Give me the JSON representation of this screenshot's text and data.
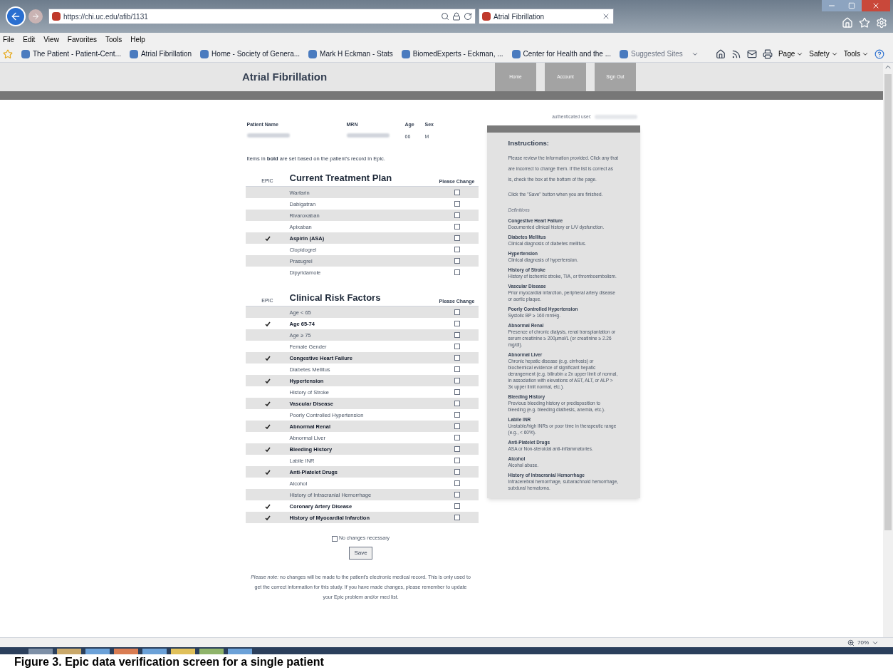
{
  "browser": {
    "url": "https://chi.uc.edu/afib/1131",
    "tab_title": "Atrial Fibrillation",
    "menu": [
      "File",
      "Edit",
      "View",
      "Favorites",
      "Tools",
      "Help"
    ],
    "favorites": [
      "The Patient - Patient-Cent...",
      "Atrial Fibrillation",
      "Home - Society of Genera...",
      "Mark H Eckman - Stats",
      "BiomedExperts - Eckman, ...",
      "Center for Health and the ...",
      "Suggested Sites"
    ],
    "commands": [
      "Page",
      "Safety",
      "Tools"
    ],
    "zoom": "70%"
  },
  "header": {
    "title": "Atrial Fibrillation",
    "nav": [
      "Home",
      "Account",
      "Sign Out"
    ]
  },
  "auth_label": "authenticated user:",
  "patient": {
    "columns": [
      "Patient Name",
      "MRN",
      "Age",
      "Sex"
    ],
    "values": [
      {
        "redacted": true
      },
      {
        "redacted": true
      },
      {
        "redacted": false,
        "text": "66"
      },
      {
        "redacted": false,
        "text": "M"
      }
    ]
  },
  "note": "Items in **bold** are set based on the patient's record in Epic.",
  "sections": [
    {
      "epic_label": "EPIC",
      "title": "Current Treatment Plan",
      "change_label": "Please Change",
      "rows": [
        {
          "label": "Warfarin",
          "epic": false,
          "change": false
        },
        {
          "label": "Dabigatran",
          "epic": false,
          "change": false
        },
        {
          "label": "Rivaroxaban",
          "epic": false,
          "change": false
        },
        {
          "label": "Apixaban",
          "epic": false,
          "change": false
        },
        {
          "label": "Aspirin (ASA)",
          "epic": true,
          "change": false
        },
        {
          "label": "Clopidogrel",
          "epic": false,
          "change": false
        },
        {
          "label": "Prasugrel",
          "epic": false,
          "change": false
        },
        {
          "label": "Dipyridamole",
          "epic": false,
          "change": false
        }
      ]
    },
    {
      "epic_label": "EPIC",
      "title": "Clinical Risk Factors",
      "change_label": "Please Change",
      "rows": [
        {
          "label": "Age < 65",
          "epic": false,
          "change": false
        },
        {
          "label": "Age 65-74",
          "epic": true,
          "change": false
        },
        {
          "label": "Age ≥ 75",
          "epic": false,
          "change": false
        },
        {
          "label": "Female Gender",
          "epic": false,
          "change": false
        },
        {
          "label": "Congestive Heart Failure",
          "epic": true,
          "change": false
        },
        {
          "label": "Diabetes Mellitus",
          "epic": false,
          "change": false
        },
        {
          "label": "Hypertension",
          "epic": true,
          "change": false
        },
        {
          "label": "History of Stroke",
          "epic": false,
          "change": false
        },
        {
          "label": "Vascular Disease",
          "epic": true,
          "change": false
        },
        {
          "label": "Poorly Controlled Hypertension",
          "epic": false,
          "change": false
        },
        {
          "label": "Abnormal Renal",
          "epic": true,
          "change": false
        },
        {
          "label": "Abnormal Liver",
          "epic": false,
          "change": false
        },
        {
          "label": "Bleeding History",
          "epic": true,
          "change": false
        },
        {
          "label": "Labile INR",
          "epic": false,
          "change": false
        },
        {
          "label": "Anti-Platelet Drugs",
          "epic": true,
          "change": false
        },
        {
          "label": "Alcohol",
          "epic": false,
          "change": false
        },
        {
          "label": "History of Intracranial Hemorrhage",
          "epic": false,
          "change": false
        },
        {
          "label": "Coronary Artery Disease",
          "epic": true,
          "change": false
        },
        {
          "label": "History of Myocardial Infarction",
          "epic": true,
          "change": false
        }
      ]
    }
  ],
  "no_change": {
    "label": "No changes necessary",
    "checked": false
  },
  "save": "Save",
  "footer_note": "*Please note:* no changes will be made to the patient's electronic medical record. This is only used to get the correct information for this study. If you have made changes, please remember to update your Epic problem and/or med list.",
  "instructions": {
    "title": "Instructions:",
    "paragraphs": [
      "Please review the information provided. Click any that are incorrect to change them. If the list is correct as is, check the box at the bottom of the page.",
      "Click the \"Save\" button when you are finished."
    ],
    "definitions_label": "Definitions",
    "definitions": [
      {
        "term": "Congestive Heart Failure",
        "text": "Documented clinical history or L/V dysfunction."
      },
      {
        "term": "Diabetes Mellitus",
        "text": "Clinical diagnosis of diabetes mellitus."
      },
      {
        "term": "Hypertension",
        "text": "Clinical diagnosis of hypertension."
      },
      {
        "term": "History of Stroke",
        "text": "History of ischemic stroke, TIA, or thromboembolism."
      },
      {
        "term": "Vascular Disease",
        "text": "Prior myocardial infarction, peripheral artery disease or aortic plaque."
      },
      {
        "term": "Poorly Controlled Hypertension",
        "text": "Systolic BP ≥ 160 mmHg."
      },
      {
        "term": "Abnormal Renal",
        "text": "Presence of chronic dialysis, renal transplantation or serum creatinine ≥ 200µmol/L (or creatinine ≥ 2.26 mg/dl)."
      },
      {
        "term": "Abnormal Liver",
        "text": "Chronic hepatic disease (e.g. cirrhosis) or biochemical evidence of significant hepatic derangement (e.g. bilirubin ≥ 2x upper limit of normal, in association with elevations of AST, ALT, or ALP > 3x upper limit normal, etc.)."
      },
      {
        "term": "Bleeding History",
        "text": "Previous bleeding history or predisposition to bleeding (e.g. bleeding diathesis, anemia, etc.)."
      },
      {
        "term": "Labile INR",
        "text": "Unstable/high INRs or poor time in therapeutic range (e.g., < 60%)."
      },
      {
        "term": "Anti-Platelet Drugs",
        "text": "ASA or Non-steroidal anti-inflammatories."
      },
      {
        "term": "Alcohol",
        "text": "Alcohol abuse."
      },
      {
        "term": "History of Intracranial Hemorrhage",
        "text": "Intracerebral hemorrhage, subarachnoid hemorrhage, subdural hematoma."
      }
    ]
  },
  "caption": "Figure 3. Epic data verification screen for a single patient"
}
